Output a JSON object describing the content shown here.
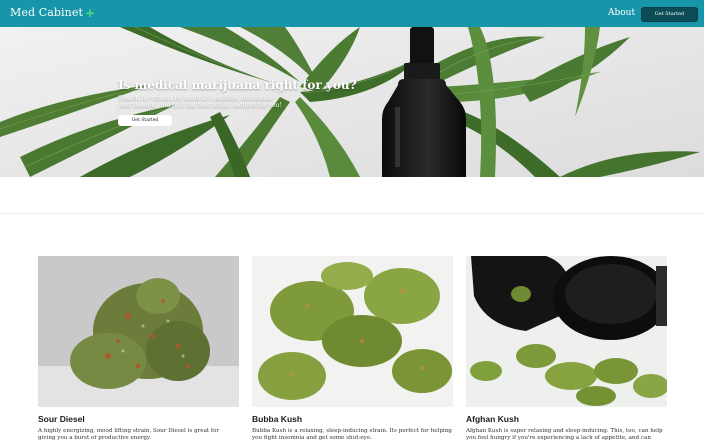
{
  "nav": {
    "brand": "Med Cabinet",
    "brand_icon": "plus-icon",
    "about": "About",
    "get_started": "Get Started",
    "colors": {
      "bar": "#1796aa",
      "button": "#0b4c57",
      "plus": "#4ee27b"
    }
  },
  "hero": {
    "title": "Is medical marijuana right for you?",
    "subtitle": "Search for strains by medical condition, determine your dosage, and find the best intake method for you!",
    "button": "Get Started"
  },
  "strains": [
    {
      "name": "Sour Diesel",
      "description": "A highly energizing, mood lifting strain, Sour Diesel is great for giving you a burst of productive energy."
    },
    {
      "name": "Bubba Kush",
      "description": "Bubba Kush is a relaxing, sleep-inducing strain. Its perfect for helping you fight insomnia and get some shut-eye."
    },
    {
      "name": "Afghan Kush",
      "description": "Afghan Kush is super relaxing and sleep-inducing. This, too, can help you feel hungry if you're experiencing a lack of appetite, and can"
    }
  ]
}
